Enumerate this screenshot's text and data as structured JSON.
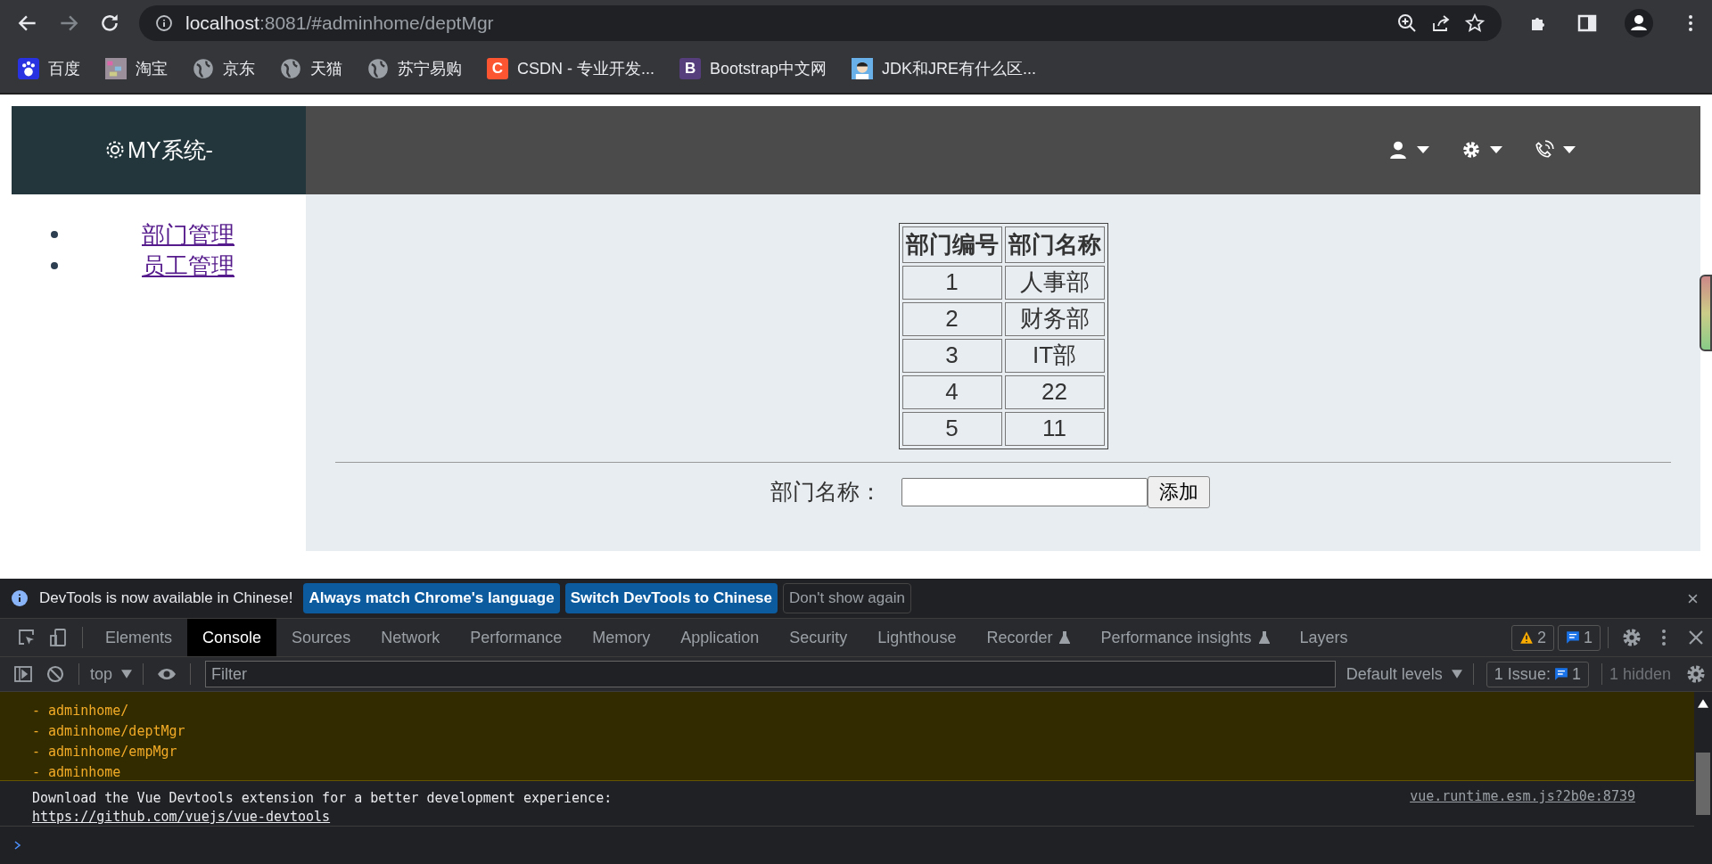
{
  "browser": {
    "url": {
      "host": "localhost",
      "rest": ":8081/#adminhome/deptMgr"
    },
    "bookmarks": [
      {
        "label": "百度",
        "kind": "paw"
      },
      {
        "label": "淘宝",
        "kind": "mosaic"
      },
      {
        "label": "京东",
        "kind": "globe"
      },
      {
        "label": "天猫",
        "kind": "globe"
      },
      {
        "label": "苏宁易购",
        "kind": "globe"
      },
      {
        "label": "CSDN - 专业开发...",
        "kind": "letter",
        "letter": "C",
        "color": "#fc5531"
      },
      {
        "label": "Bootstrap中文网",
        "kind": "letter",
        "letter": "B",
        "color": "#563d7c"
      },
      {
        "label": "JDK和JRE有什么区...",
        "kind": "avatar"
      }
    ]
  },
  "app": {
    "title": "MY系统-",
    "header_menus": [
      {
        "kind": "user"
      },
      {
        "kind": "gear"
      },
      {
        "kind": "phone"
      }
    ],
    "sidebar": {
      "items": [
        {
          "label": "部门管理"
        },
        {
          "label": "员工管理"
        }
      ]
    },
    "table": {
      "columns": [
        "部门编号",
        "部门名称"
      ],
      "rows": [
        [
          "1",
          "人事部"
        ],
        [
          "2",
          "财务部"
        ],
        [
          "3",
          "IT部"
        ],
        [
          "4",
          "22"
        ],
        [
          "5",
          "11"
        ]
      ]
    },
    "form": {
      "label": "部门名称：",
      "button": "添加"
    }
  },
  "devtools": {
    "notice": {
      "text": "DevTools is now available in Chinese!",
      "buttons": [
        {
          "label": "Always match Chrome's language",
          "kind": "primary"
        },
        {
          "label": "Switch DevTools to Chinese",
          "kind": "primary"
        },
        {
          "label": "Don't show again",
          "kind": "plain"
        }
      ]
    },
    "tabs": [
      {
        "label": "Elements",
        "selected": false,
        "experimental": false
      },
      {
        "label": "Console",
        "selected": true,
        "experimental": false
      },
      {
        "label": "Sources",
        "selected": false,
        "experimental": false
      },
      {
        "label": "Network",
        "selected": false,
        "experimental": false
      },
      {
        "label": "Performance",
        "selected": false,
        "experimental": false
      },
      {
        "label": "Memory",
        "selected": false,
        "experimental": false
      },
      {
        "label": "Application",
        "selected": false,
        "experimental": false
      },
      {
        "label": "Security",
        "selected": false,
        "experimental": false
      },
      {
        "label": "Lighthouse",
        "selected": false,
        "experimental": false
      },
      {
        "label": "Recorder",
        "selected": false,
        "experimental": true
      },
      {
        "label": "Performance insights",
        "selected": false,
        "experimental": true
      },
      {
        "label": "Layers",
        "selected": false,
        "experimental": false
      }
    ],
    "warning_count": "2",
    "info_count": "1",
    "console_toolbar": {
      "context": "top",
      "filter_placeholder": "Filter",
      "levels": "Default levels",
      "issues_label": "1 Issue:",
      "issues_count": "1",
      "hidden": "1 hidden"
    },
    "messages": [
      {
        "kind": "warning",
        "lines": [
          "- adminhome/",
          "- adminhome/deptMgr",
          "- adminhome/empMgr",
          "- adminhome"
        ]
      },
      {
        "kind": "info",
        "lines": [
          "Download the Vue Devtools extension for a better development experience:"
        ],
        "link": "https://github.com/vuejs/vue-devtools",
        "source": "vue.runtime.esm.js?2b0e:8739"
      }
    ]
  }
}
